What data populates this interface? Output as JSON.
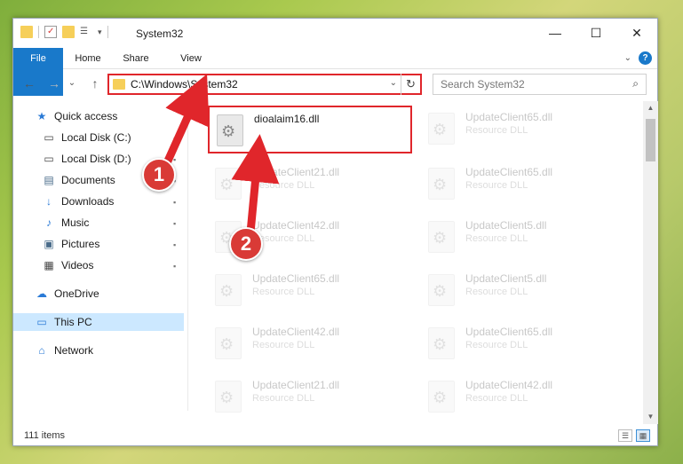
{
  "window": {
    "title": "System32",
    "controls": {
      "minimize": "—",
      "maximize": "☐",
      "close": "✕"
    }
  },
  "ribbon": {
    "tabs": [
      "File",
      "Home",
      "Share",
      "View"
    ],
    "help": "?"
  },
  "navigation": {
    "back": "←",
    "forward": "→",
    "dropdown": "⌄",
    "up": "↑",
    "address": "C:\\Windows\\System32",
    "address_dropdown": "⌄",
    "refresh": "↻",
    "search_placeholder": "Search System32",
    "search_icon": "⌕"
  },
  "sidebar": {
    "items": [
      {
        "label": "Quick access",
        "icon": "star-icon",
        "glyph": "★",
        "color": "#2a7ad6",
        "pinned": false
      },
      {
        "label": "Local Disk (C:)",
        "icon": "drive-icon",
        "glyph": "▭",
        "color": "#444444",
        "pinned": true
      },
      {
        "label": "Local Disk (D:)",
        "icon": "drive-icon",
        "glyph": "▭",
        "color": "#444444",
        "pinned": true
      },
      {
        "label": "Documents",
        "icon": "documents-icon",
        "glyph": "▤",
        "color": "#4a6c8a",
        "pinned": true
      },
      {
        "label": "Downloads",
        "icon": "downloads-icon",
        "glyph": "↓",
        "color": "#2a7ad6",
        "pinned": true
      },
      {
        "label": "Music",
        "icon": "music-icon",
        "glyph": "♪",
        "color": "#2a7ad6",
        "pinned": true
      },
      {
        "label": "Pictures",
        "icon": "pictures-icon",
        "glyph": "▣",
        "color": "#4a6c8a",
        "pinned": true
      },
      {
        "label": "Videos",
        "icon": "videos-icon",
        "glyph": "▦",
        "color": "#444444",
        "pinned": true
      },
      {
        "label": "OneDrive",
        "icon": "onedrive-icon",
        "glyph": "☁",
        "color": "#2a7ad6",
        "pinned": false
      },
      {
        "label": "This PC",
        "icon": "pc-icon",
        "glyph": "▭",
        "color": "#2a7ad6",
        "pinned": false,
        "selected": true
      },
      {
        "label": "Network",
        "icon": "network-icon",
        "glyph": "⌂",
        "color": "#2a7ad6",
        "pinned": false
      }
    ],
    "pin_glyph": "📌"
  },
  "files": [
    {
      "name": "dioalaim16.dll",
      "type": "",
      "faded": false,
      "highlight": true
    },
    {
      "name": "UpdateClient65.dll",
      "type": "Resource DLL",
      "faded": true
    },
    {
      "name": "UpdateClient21.dll",
      "type": "Resource DLL",
      "faded": true
    },
    {
      "name": "UpdateClient65.dll",
      "type": "Resource DLL",
      "faded": true
    },
    {
      "name": "UpdateClient42.dll",
      "type": "Resource DLL",
      "faded": true
    },
    {
      "name": "UpdateClient5.dll",
      "type": "Resource DLL",
      "faded": true
    },
    {
      "name": "UpdateClient65.dll",
      "type": "Resource DLL",
      "faded": true
    },
    {
      "name": "UpdateClient5.dll",
      "type": "Resource DLL",
      "faded": true
    },
    {
      "name": "UpdateClient42.dll",
      "type": "Resource DLL",
      "faded": true
    },
    {
      "name": "UpdateClient65.dll",
      "type": "Resource DLL",
      "faded": true
    },
    {
      "name": "UpdateClient21.dll",
      "type": "Resource DLL",
      "faded": true
    },
    {
      "name": "UpdateClient42.dll",
      "type": "Resource DLL",
      "faded": true
    }
  ],
  "status": {
    "count": "111 items"
  },
  "annotations": {
    "step1": "1",
    "step2": "2",
    "color": "#e0262b"
  }
}
